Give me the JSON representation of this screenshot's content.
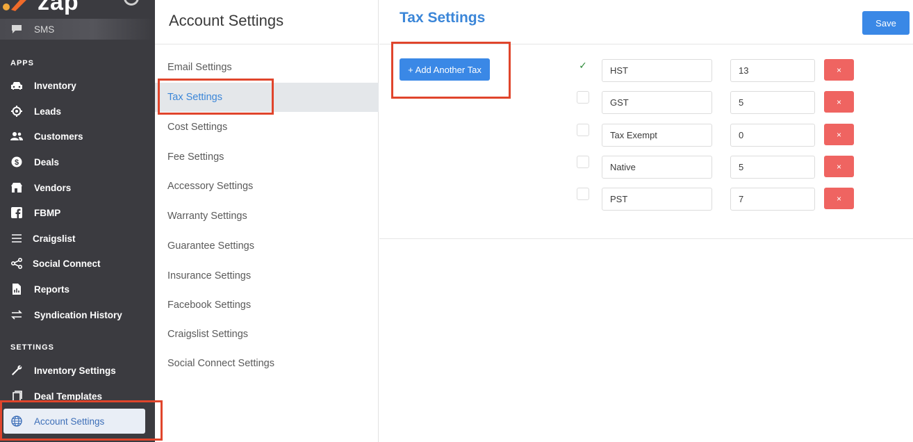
{
  "sidebar": {
    "logo_text": "zap",
    "sms_label": "SMS",
    "apps_title": "APPS",
    "apps": [
      {
        "label": "Inventory",
        "icon": "car-icon"
      },
      {
        "label": "Leads",
        "icon": "target-icon"
      },
      {
        "label": "Customers",
        "icon": "users-icon"
      },
      {
        "label": "Deals",
        "icon": "dollar-icon"
      },
      {
        "label": "Vendors",
        "icon": "store-icon"
      },
      {
        "label": "FBMP",
        "icon": "facebook-icon"
      },
      {
        "label": "Craigslist",
        "icon": "list-icon"
      },
      {
        "label": "Social Connect",
        "icon": "share-icon"
      },
      {
        "label": "Reports",
        "icon": "report-icon"
      },
      {
        "label": "Syndication History",
        "icon": "swap-icon"
      }
    ],
    "settings_title": "SETTINGS",
    "settings": [
      {
        "label": "Inventory Settings",
        "icon": "wrench-icon"
      },
      {
        "label": "Deal Templates",
        "icon": "template-icon"
      },
      {
        "label": "Account Settings",
        "icon": "globe-icon"
      }
    ]
  },
  "middle": {
    "title": "Account Settings",
    "items": [
      "Email Settings",
      "Tax Settings",
      "Cost Settings",
      "Fee Settings",
      "Accessory Settings",
      "Warranty Settings",
      "Guarantee Settings",
      "Insurance Settings",
      "Facebook Settings",
      "Craigslist Settings",
      "Social Connect Settings"
    ],
    "active_index": 1
  },
  "main": {
    "title": "Tax Settings",
    "save_label": "Save",
    "add_label": "+ Add Another Tax",
    "delete_label": "×",
    "check_mark": "✓",
    "taxes": [
      {
        "name": "HST",
        "rate": "13",
        "checked": true
      },
      {
        "name": "GST",
        "rate": "5",
        "checked": false
      },
      {
        "name": "Tax Exempt",
        "rate": "0",
        "checked": false
      },
      {
        "name": "Native",
        "rate": "5",
        "checked": false
      },
      {
        "name": "PST",
        "rate": "7",
        "checked": false
      }
    ]
  },
  "colors": {
    "sidebar_bg": "#3b3b40",
    "accent": "#3a88e6",
    "delete": "#ef6461",
    "highlight": "#e0452c"
  }
}
